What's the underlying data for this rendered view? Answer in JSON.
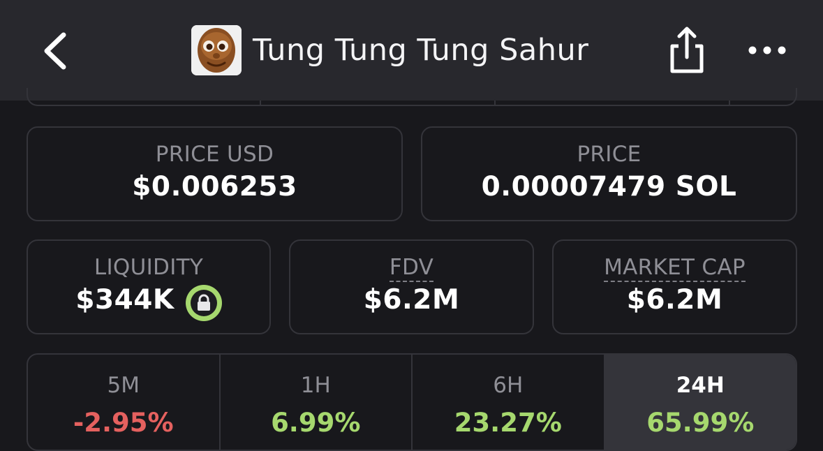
{
  "header": {
    "title": "Tung Tung Tung Sahur",
    "back_icon": "chevron-left-icon",
    "share_icon": "share-icon",
    "more_icon": "more-horizontal-icon"
  },
  "price_usd": {
    "label": "PRICE USD",
    "value": "$0.006253"
  },
  "price_native": {
    "label": "PRICE",
    "value": "0.00007479 SOL"
  },
  "liquidity": {
    "label": "LIQUIDITY",
    "value": "$344K",
    "locked_icon": "lock-icon"
  },
  "fdv": {
    "label": "FDV",
    "value": "$6.2M"
  },
  "market_cap": {
    "label": "MARKET CAP",
    "value": "$6.2M"
  },
  "changes": [
    {
      "label": "5M",
      "value": "-2.95%",
      "color": "#e5615f"
    },
    {
      "label": "1H",
      "value": "6.99%",
      "color": "#a6d86e"
    },
    {
      "label": "6H",
      "value": "23.27%",
      "color": "#a6d86e"
    },
    {
      "label": "24H",
      "value": "65.99%",
      "color": "#a6d86e",
      "selected": true
    }
  ],
  "colors": {
    "background": "#18181c",
    "header": "#28282d",
    "border": "#34343a",
    "positive": "#a6d86e",
    "negative": "#e5615f"
  }
}
